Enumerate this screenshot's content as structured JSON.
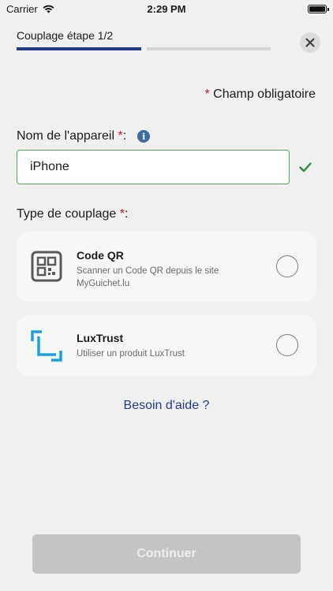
{
  "status_bar": {
    "carrier": "Carrier",
    "time": "2:29 PM"
  },
  "header": {
    "step_label": "Couplage étape 1/2",
    "progress": {
      "total_steps": 2,
      "current_step": 1
    },
    "close_icon": "close-icon"
  },
  "form": {
    "required_note": "Champ obligatoire",
    "asterisk": "*",
    "device_name_label": "Nom de l'appareil",
    "label_suffix": " :",
    "device_name_value": "iPhone",
    "pairing_type_label": "Type de couplage"
  },
  "options": [
    {
      "title": "Code QR",
      "description": "Scanner un Code QR depuis le site MyGuichet.lu",
      "icon": "qr-code-icon",
      "selected": false
    },
    {
      "title": "LuxTrust",
      "description": "Utiliser un produit LuxTrust",
      "icon": "luxtrust-icon",
      "selected": false
    }
  ],
  "help_link": "Besoin d'aide ?",
  "continue_button": "Continuer",
  "colors": {
    "accent": "#1f3c88",
    "required": "#c8102e",
    "valid": "#4caf50",
    "info": "#3a6ea5",
    "luxtrust": "#1aa0dc"
  }
}
